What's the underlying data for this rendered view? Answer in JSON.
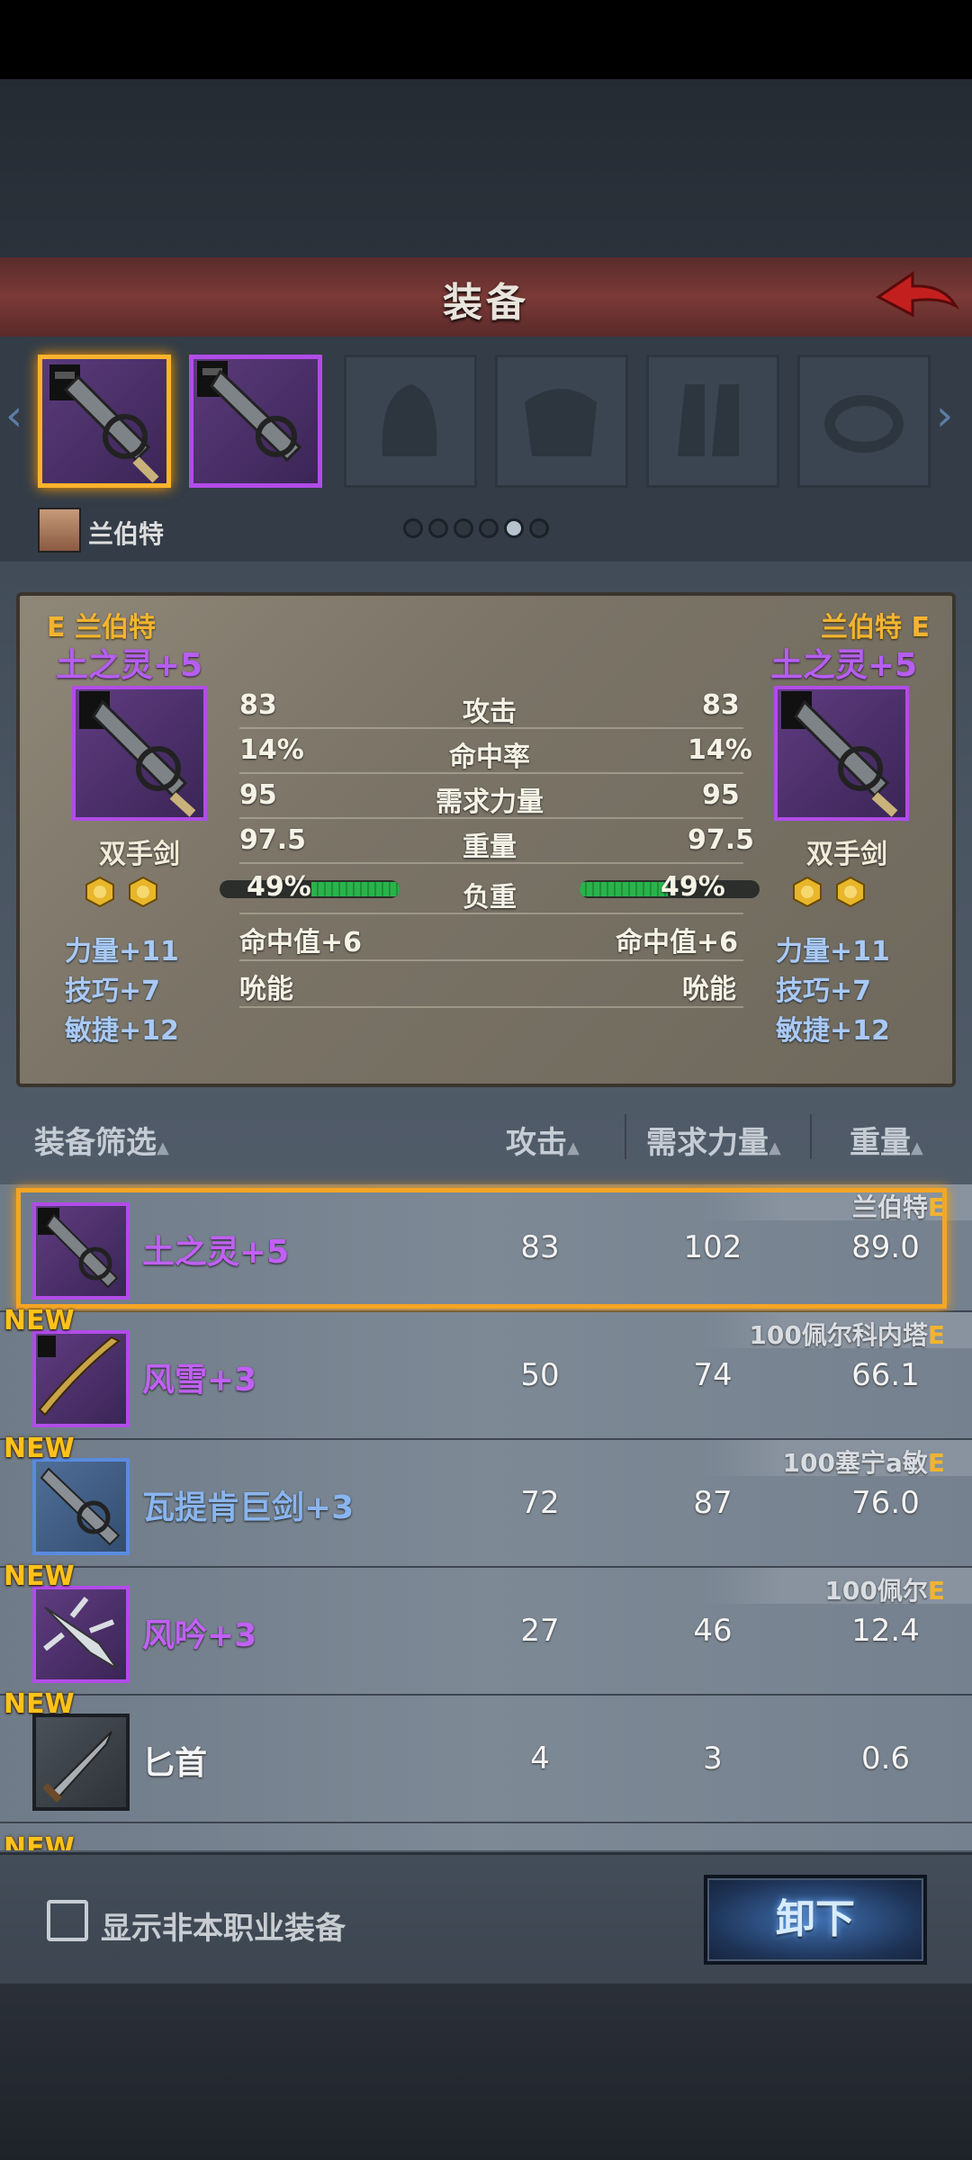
{
  "header": {
    "title": "装备"
  },
  "slots": {
    "character": "兰伯特",
    "pages": 6,
    "active_page": 5
  },
  "compare": {
    "left": {
      "grade": "E",
      "owner": "兰伯特",
      "name": "土之灵+5",
      "type": "双手剑",
      "attack": "83",
      "hit_rate": "14%",
      "str_req": "95",
      "weight": "97.5",
      "load": "49%",
      "load_fraction": 0.49,
      "extra1": "命中值+6",
      "extra2": "吮能",
      "bonuses": [
        "力量+11",
        "技巧+7",
        "敏捷+12"
      ]
    },
    "right": {
      "grade": "E",
      "owner": "兰伯特",
      "name": "土之灵+5",
      "type": "双手剑",
      "attack": "83",
      "hit_rate": "14%",
      "str_req": "95",
      "weight": "97.5",
      "load": "49%",
      "load_fraction": 0.49,
      "extra1": "命中值+6",
      "extra2": "吮能",
      "bonuses": [
        "力量+11",
        "技巧+7",
        "敏捷+12"
      ]
    },
    "labels": {
      "attack": "攻击",
      "hit_rate": "命中率",
      "str_req": "需求力量",
      "weight": "重量",
      "load": "负重"
    }
  },
  "list": {
    "headers": {
      "filter": "装备筛选",
      "attack": "攻击",
      "str_req": "需求力量",
      "weight": "重量"
    },
    "rows": [
      {
        "name": "土之灵+5",
        "attack": "83",
        "str_req": "102",
        "weight": "89.0",
        "owner": "兰伯特",
        "grade": "E",
        "new": "",
        "rarity": "purple",
        "selected": true
      },
      {
        "name": "风雪+3",
        "attack": "50",
        "str_req": "74",
        "weight": "66.1",
        "owner": "100佩尔科内塔",
        "grade": "E",
        "new": "NEW",
        "rarity": "purple",
        "selected": false
      },
      {
        "name": "瓦提肯巨剑+3",
        "attack": "72",
        "str_req": "87",
        "weight": "76.0",
        "owner": "100塞宁a敏",
        "grade": "E",
        "new": "NEW",
        "rarity": "blue",
        "selected": false
      },
      {
        "name": "风吟+3",
        "attack": "27",
        "str_req": "46",
        "weight": "12.4",
        "owner": "100佩尔",
        "grade": "E",
        "new": "NEW",
        "rarity": "purple",
        "selected": false
      },
      {
        "name": "匕首",
        "attack": "4",
        "str_req": "3",
        "weight": "0.6",
        "owner": "",
        "grade": "",
        "new": "NEW",
        "rarity": "gray",
        "selected": false
      }
    ],
    "partial_new": "NEW"
  },
  "footer": {
    "checkbox_label": "显示非本职业装备",
    "checkbox_checked": false,
    "unequip_label": "卸下"
  },
  "colors": {
    "purple": "#b14ce8",
    "gold_select": "#ffb32c",
    "owner_gold": "#f2b430",
    "header_red": "#7a3a36"
  }
}
